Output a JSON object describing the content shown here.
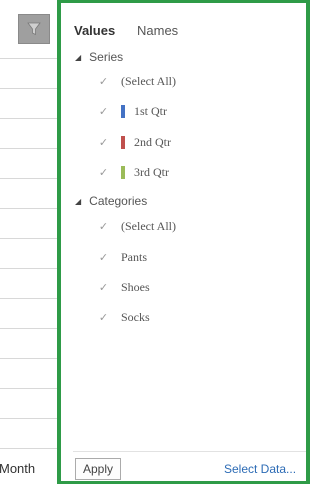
{
  "sheet": {
    "month_label": "Month"
  },
  "tabs": [
    {
      "label": "Values",
      "active": true
    },
    {
      "label": "Names",
      "active": false
    }
  ],
  "sections": {
    "series": {
      "title": "Series",
      "items": [
        {
          "label": "(Select All)",
          "checked": true
        },
        {
          "label": "1st Qtr",
          "checked": true,
          "color": "#4472c4"
        },
        {
          "label": "2nd Qtr",
          "checked": true,
          "color": "#c0504d"
        },
        {
          "label": "3rd Qtr",
          "checked": true,
          "color": "#9bbb59"
        }
      ]
    },
    "categories": {
      "title": "Categories",
      "items": [
        {
          "label": "(Select All)",
          "checked": true
        },
        {
          "label": "Pants",
          "checked": true
        },
        {
          "label": "Shoes",
          "checked": true
        },
        {
          "label": "Socks",
          "checked": true
        }
      ]
    }
  },
  "footer": {
    "apply_label": "Apply",
    "select_data_label": "Select Data..."
  },
  "colors": {
    "frame": "#2e9b47",
    "link": "#2c6bb5"
  }
}
